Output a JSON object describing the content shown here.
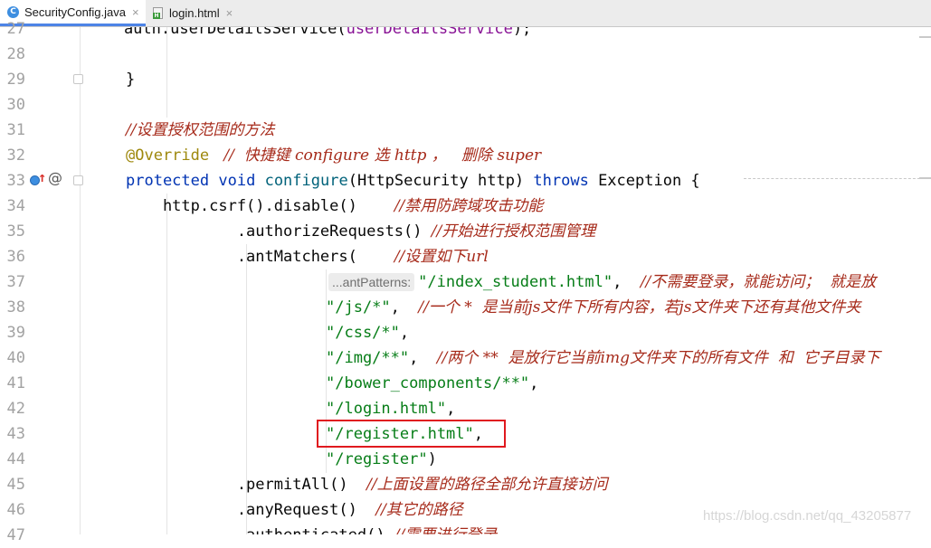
{
  "tabs": [
    {
      "label": "SecurityConfig.java",
      "icon": "java-class-icon",
      "active": true
    },
    {
      "label": "login.html",
      "icon": "html-file-icon",
      "active": false
    }
  ],
  "tab_close_glyph": "×",
  "line_numbers": [
    "27",
    "28",
    "29",
    "30",
    "31",
    "32",
    "33",
    "34",
    "35",
    "36",
    "37",
    "38",
    "39",
    "40",
    "41",
    "42",
    "43",
    "44",
    "45",
    "46",
    "47"
  ],
  "gutter_icons": {
    "override": "override-method-icon",
    "at": "@"
  },
  "code": {
    "l27_a": "    auth.userDetailsService(",
    "l27_b": "userDetailsService",
    "l27_c": ");",
    "l29": "}",
    "l31": "//设置授权范围的方法",
    "l32_ann": "@Override",
    "l32_cmt": "   //  快捷键 configure 选 http ，   删除 super",
    "l33_kw1": "protected",
    "l33_kw2": "void",
    "l33_fn": "configure",
    "l33_a": "(HttpSecurity http) ",
    "l33_kw3": "throws",
    "l33_b": " Exception {",
    "l34_a": "    http.csrf().disable()    ",
    "l34_cmt": "//禁用防跨域攻击功能",
    "l35_a": "            .authorizeRequests() ",
    "l35_cmt": "//开始进行授权范围管理",
    "l36_a": "            .antMatchers(    ",
    "l36_cmt": "//设置如下url",
    "l37_hint": "...antPatterns:",
    "l37_str": "\"/index_student.html\"",
    "l37_b": ",  ",
    "l37_cmt": "//不需要登录，就能访问；  就是放",
    "l38_str": "\"/js/*\"",
    "l38_b": ",  ",
    "l38_cmt": "//一个 *  是当前js文件下所有内容，若js文件夹下还有其他文件夹",
    "l39_str": "\"/css/*\"",
    "l39_b": ",",
    "l40_str": "\"/img/**\"",
    "l40_b": ",  ",
    "l40_cmt": "//两个 **  是放行它当前img文件夹下的所有文件  和  它子目录下",
    "l41_str": "\"/bower_components/**\"",
    "l41_b": ",",
    "l42_str": "\"/login.html\"",
    "l42_b": ",",
    "l43_str": "\"/register.html\"",
    "l43_b": ",",
    "l44_str": "\"/register\"",
    "l44_b": ")",
    "l45_a": "            .permitAll()  ",
    "l45_cmt": "//上面设置的路径全部允许直接访问",
    "l46_a": "            .anyRequest()  ",
    "l46_cmt": "//其它的路径",
    "l47_a": "            .authenticated() ",
    "l47_cmt": "//需要进行登录"
  },
  "watermark": "https://blog.csdn.net/qq_43205877",
  "colors": {
    "keyword": "#0033b3",
    "string": "#067d17",
    "annotation": "#9e880d",
    "comment": "#a62a1a",
    "highlight": "#e0191f"
  }
}
